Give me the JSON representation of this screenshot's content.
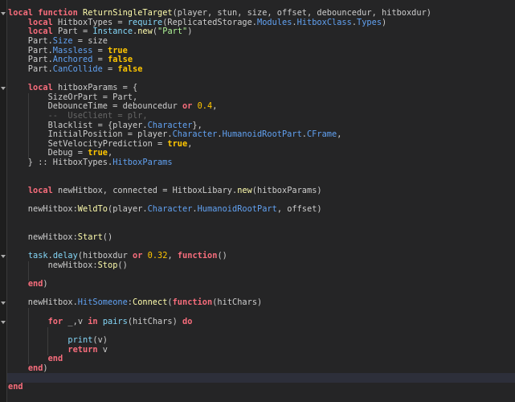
{
  "editor": {
    "current_line": 40,
    "fold_lines": [
      1,
      9,
      27,
      32,
      34
    ],
    "lines": [
      [
        [
          "local",
          "k"
        ],
        [
          " ",
          "t"
        ],
        [
          "function",
          "k"
        ],
        [
          " ",
          "t"
        ],
        [
          "ReturnSingleTarget",
          "f"
        ],
        [
          "(player, stun, size, offset, debouncedur, hitboxdur)",
          "t"
        ]
      ],
      [
        [
          "    ",
          "t"
        ],
        [
          "local",
          "k"
        ],
        [
          " HitboxTypes = ",
          "t"
        ],
        [
          "require",
          "g"
        ],
        [
          "(ReplicatedStorage.",
          "t"
        ],
        [
          "Modules",
          "p"
        ],
        [
          ".",
          "t"
        ],
        [
          "HitboxClass",
          "p"
        ],
        [
          ".",
          "t"
        ],
        [
          "Types",
          "p"
        ],
        [
          ")",
          "t"
        ]
      ],
      [
        [
          "    ",
          "t"
        ],
        [
          "local",
          "k"
        ],
        [
          " Part = ",
          "t"
        ],
        [
          "Instance",
          "g"
        ],
        [
          ".",
          "t"
        ],
        [
          "new",
          "f"
        ],
        [
          "(",
          "t"
        ],
        [
          "\"Part\"",
          "s"
        ],
        [
          ")",
          "t"
        ]
      ],
      [
        [
          "    Part.",
          "t"
        ],
        [
          "Size",
          "p"
        ],
        [
          " = size",
          "t"
        ]
      ],
      [
        [
          "    Part.",
          "t"
        ],
        [
          "Massless",
          "p"
        ],
        [
          " = ",
          "t"
        ],
        [
          "true",
          "b"
        ]
      ],
      [
        [
          "    Part.",
          "t"
        ],
        [
          "Anchored",
          "p"
        ],
        [
          " = ",
          "t"
        ],
        [
          "false",
          "b"
        ]
      ],
      [
        [
          "    Part.",
          "t"
        ],
        [
          "CanCollide",
          "p"
        ],
        [
          " = ",
          "t"
        ],
        [
          "false",
          "b"
        ]
      ],
      [],
      [
        [
          "    ",
          "t"
        ],
        [
          "local",
          "k"
        ],
        [
          " hitboxParams = {",
          "t"
        ]
      ],
      [
        [
          "        SizeOrPart = Part,",
          "t"
        ]
      ],
      [
        [
          "        DebounceTime = debouncedur ",
          "t"
        ],
        [
          "or",
          "k"
        ],
        [
          " ",
          "t"
        ],
        [
          "0.4",
          "n"
        ],
        [
          ",",
          "t"
        ]
      ],
      [
        [
          "        --  UseClient = plr,",
          "c"
        ]
      ],
      [
        [
          "        Blacklist = {player.",
          "t"
        ],
        [
          "Character",
          "p"
        ],
        [
          "},",
          "t"
        ]
      ],
      [
        [
          "        InitialPosition = player.",
          "t"
        ],
        [
          "Character",
          "p"
        ],
        [
          ".",
          "t"
        ],
        [
          "HumanoidRootPart",
          "p"
        ],
        [
          ".",
          "t"
        ],
        [
          "CFrame",
          "p"
        ],
        [
          ",",
          "t"
        ]
      ],
      [
        [
          "        SetVelocityPrediction = ",
          "t"
        ],
        [
          "true",
          "b"
        ],
        [
          ",",
          "t"
        ]
      ],
      [
        [
          "        Debug = ",
          "t"
        ],
        [
          "true",
          "b"
        ],
        [
          ",",
          "t"
        ]
      ],
      [
        [
          "    } :: HitboxTypes.",
          "t"
        ],
        [
          "HitboxParams",
          "p"
        ]
      ],
      [],
      [],
      [
        [
          "    ",
          "t"
        ],
        [
          "local",
          "k"
        ],
        [
          " newHitbox, connected = HitboxLibary.",
          "t"
        ],
        [
          "new",
          "f"
        ],
        [
          "(hitboxParams)",
          "t"
        ]
      ],
      [],
      [
        [
          "    newHitbox:",
          "t"
        ],
        [
          "WeldTo",
          "f"
        ],
        [
          "(player.",
          "t"
        ],
        [
          "Character",
          "p"
        ],
        [
          ".",
          "t"
        ],
        [
          "HumanoidRootPart",
          "p"
        ],
        [
          ", offset)",
          "t"
        ]
      ],
      [],
      [],
      [
        [
          "    newHitbox:",
          "t"
        ],
        [
          "Start",
          "f"
        ],
        [
          "()",
          "t"
        ]
      ],
      [],
      [
        [
          "    ",
          "t"
        ],
        [
          "task",
          "g"
        ],
        [
          ".",
          "t"
        ],
        [
          "delay",
          "g"
        ],
        [
          "(hitboxdur ",
          "t"
        ],
        [
          "or",
          "k"
        ],
        [
          " ",
          "t"
        ],
        [
          "0.32",
          "n"
        ],
        [
          ", ",
          "t"
        ],
        [
          "function",
          "k"
        ],
        [
          "()",
          "t"
        ]
      ],
      [
        [
          "        newHitbox:",
          "t"
        ],
        [
          "Stop",
          "f"
        ],
        [
          "()",
          "t"
        ]
      ],
      [],
      [
        [
          "    ",
          "t"
        ],
        [
          "end",
          "k"
        ],
        [
          ")",
          "t"
        ]
      ],
      [],
      [
        [
          "    newHitbox.",
          "t"
        ],
        [
          "HitSomeone",
          "p"
        ],
        [
          ":",
          "t"
        ],
        [
          "Connect",
          "f"
        ],
        [
          "(",
          "t"
        ],
        [
          "function",
          "k"
        ],
        [
          "(hitChars)",
          "t"
        ]
      ],
      [],
      [
        [
          "        ",
          "t"
        ],
        [
          "for",
          "k"
        ],
        [
          " _,v ",
          "t"
        ],
        [
          "in",
          "k"
        ],
        [
          " ",
          "t"
        ],
        [
          "pairs",
          "g"
        ],
        [
          "(hitChars) ",
          "t"
        ],
        [
          "do",
          "k"
        ]
      ],
      [],
      [
        [
          "            ",
          "t"
        ],
        [
          "print",
          "g"
        ],
        [
          "(v)",
          "t"
        ]
      ],
      [
        [
          "            ",
          "t"
        ],
        [
          "return",
          "k"
        ],
        [
          " v",
          "t"
        ]
      ],
      [
        [
          "        ",
          "t"
        ],
        [
          "end",
          "k"
        ]
      ],
      [
        [
          "    ",
          "t"
        ],
        [
          "end",
          "k"
        ],
        [
          ")",
          "t"
        ]
      ],
      [],
      [
        [
          "end",
          "k"
        ]
      ]
    ]
  }
}
